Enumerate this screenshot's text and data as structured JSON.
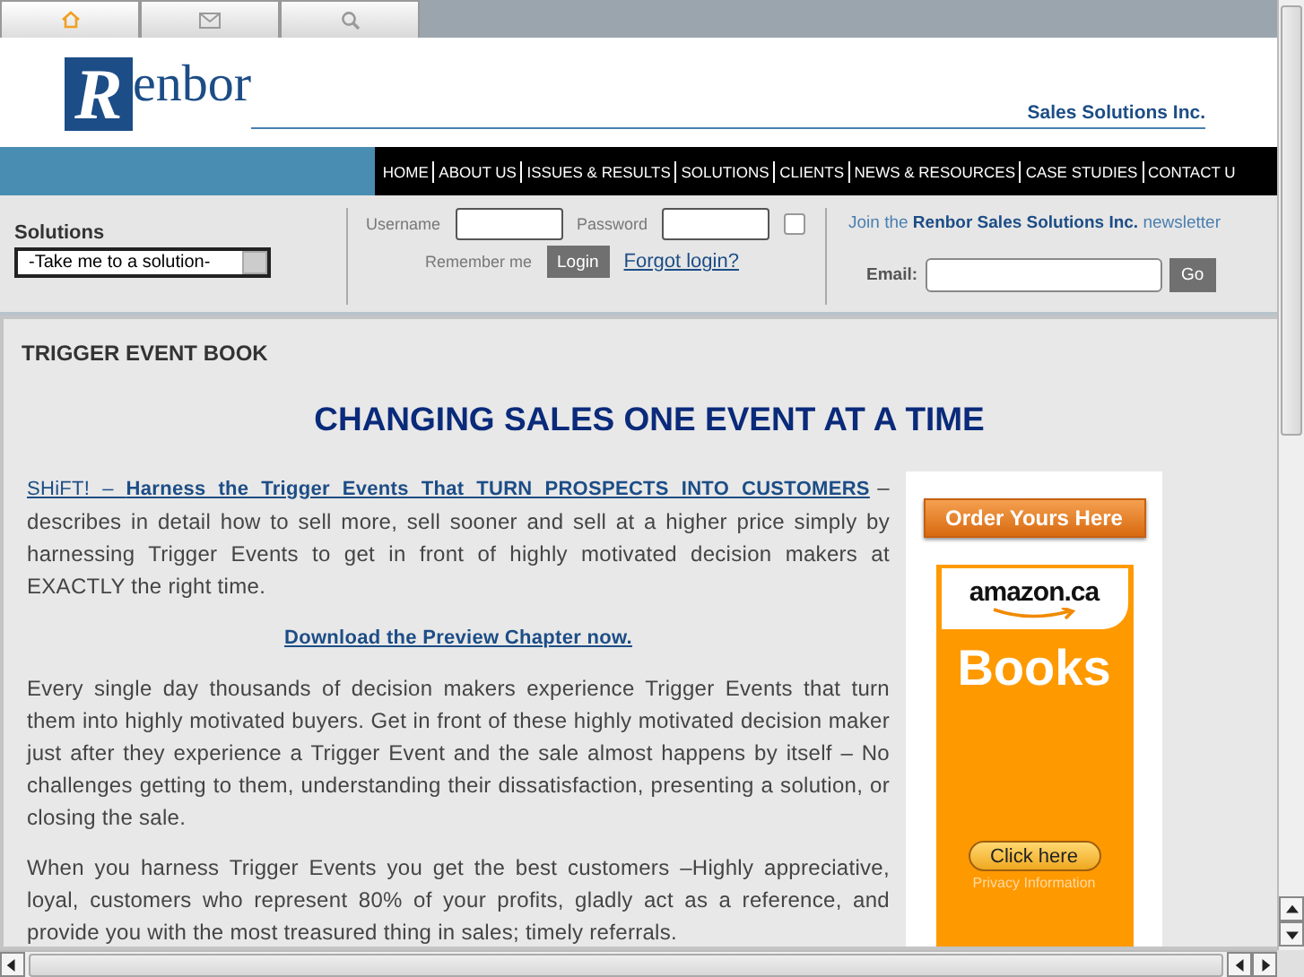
{
  "toolbar": {
    "tabs": [
      {
        "kind": "home",
        "selected": true
      },
      {
        "kind": "mail",
        "selected": false
      },
      {
        "kind": "search",
        "selected": false
      }
    ]
  },
  "header": {
    "logo_initial": "R",
    "logo_rest": "enbor",
    "tagline": "Sales Solutions Inc."
  },
  "nav": [
    "HOME",
    "ABOUT US",
    "ISSUES & RESULTS",
    "SOLUTIONS",
    "CLIENTS",
    "NEWS & RESOURCES",
    "CASE STUDIES",
    "CONTACT U"
  ],
  "solutions": {
    "label": "Solutions",
    "value": "-Take me to a solution-"
  },
  "login": {
    "username_label": "Username",
    "password_label": "Password",
    "remember_label": "Remember me",
    "remember_checked": false,
    "button": "Login",
    "forgot": "Forgot login?"
  },
  "newsletter": {
    "text": "Join the **Renbor Sales Solutions Inc.** newsletter",
    "email_label": "Email:",
    "button": "Go"
  },
  "content": {
    "section_title": "TRIGGER EVENT BOOK",
    "headline": "CHANGING SALES ONE EVENT AT A TIME",
    "intro_link": "SHiFT!  – **Harness the Trigger Events That TURN PROSPECTS INTO CUSTOMERS**",
    "intro_rest": " – describes in detail how to sell more, sell sooner and sell at a higher price simply by harnessing Trigger Events to get in front of highly motivated decision makers at EXACTLY the right time.",
    "download": "Download the Preview Chapter now.",
    "paragraphs": [
      "Every single day thousands of decision makers experience Trigger Events that turn them into highly motivated buyers. Get in front of these highly motivated decision maker just after they experience a Trigger Event and the sale almost happens by itself – No challenges getting to them, understanding their dissatisfaction, presenting a solution, or closing the sale.",
      "When you harness Trigger Events you get the best customers –Highly appreciative, loyal, customers who represent 80% of your profits, gladly act as a reference, and provide you with the most treasured thing in sales; timely referrals."
    ]
  },
  "ad": {
    "order_button": "Order Yours Here",
    "brand": "amazon.ca",
    "category": "Books",
    "cta": "Click here",
    "privacy": "Privacy Information"
  }
}
